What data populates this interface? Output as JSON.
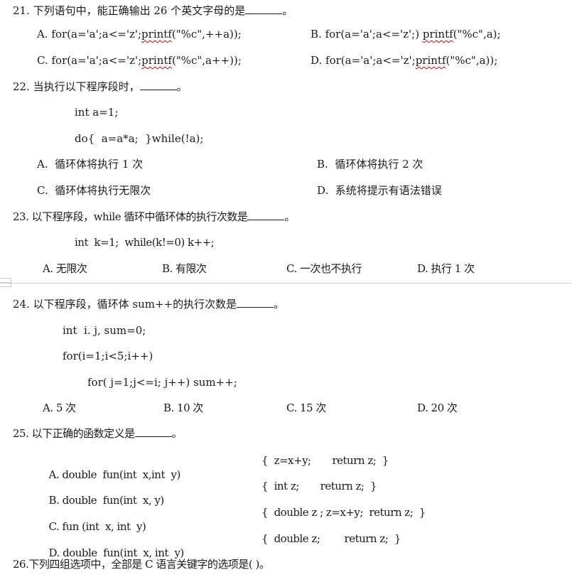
{
  "questions": {
    "q21": {
      "stem": "21. 下列语句中，能正确输出 26 个英文字母的是",
      "end": "。",
      "options": {
        "A": {
          "label": "A.",
          "pre": "for(a='a';a<='z';",
          "fn": "printf",
          "post": "(\"%c\",++a));"
        },
        "B": {
          "label": "B.",
          "pre": "for(a='a';a<='z';) ",
          "fn": "printf",
          "post": "(\"%c\",a);"
        },
        "C": {
          "label": "C.",
          "pre": "for(a='a';a<='z';",
          "fn": "printf",
          "post": "(\"%c\",a++));"
        },
        "D": {
          "label": "D.",
          "pre": "for(a='a';a<='z';",
          "fn": "printf",
          "post": "(\"%c\",a));"
        }
      }
    },
    "q22": {
      "stem": "22. 当执行以下程序段时，",
      "end": "。",
      "code": [
        "int a=1;",
        "do{  a=a*a;  }while(!a);"
      ],
      "options": {
        "A": "A.  循环体将执行 1 次",
        "B": "B.  循环体将执行 2 次",
        "C": "C.  循环体将执行无限次",
        "D": "D.  系统将提示有语法错误"
      }
    },
    "q23": {
      "stem": "23. 以下程序段，while 循环中循环体的执行次数是",
      "end": "。",
      "code": [
        "int  k=1;  while(k!=0) k++;"
      ],
      "options": {
        "A": "A. 无限次",
        "B": "B. 有限次",
        "C": "C. 一次也不执行",
        "D": "D. 执行 1 次"
      }
    },
    "q24": {
      "stem": "24. 以下程序段，循环体 sum++的执行次数是",
      "end": "。",
      "code": [
        "int  i. j, sum=0;",
        "for(i=1;i<5;i++)",
        "for( j=1;j<=i; j++) sum++;"
      ],
      "options": {
        "A": "A. 5 次",
        "B": "B. 10 次",
        "C": "C. 15 次",
        "D": "D. 20 次"
      }
    },
    "q25": {
      "stem": "25. 以下正确的函数定义是",
      "end": "。",
      "options": {
        "A": {
          "head": "A. double  fun(int  x,int  y)",
          "body": "{  z=x+y;       return z;  }"
        },
        "B": {
          "head": "B. double  fun(int  x, y)",
          "body": "{  int z;       return z;  }"
        },
        "C": {
          "head": "C. fun (int  x, int  y)",
          "body": "{  double z ; z=x+y;  return z;  }"
        },
        "D": {
          "head": "D. double  fun(int  x, int  y)",
          "body": "{  double z;        return z;  }"
        }
      }
    },
    "q26": {
      "stem": "26.下列四组选项中，全部是 C 语言关键字的选项是( )。"
    }
  },
  "colors": {
    "text": "#1a1a1a",
    "spellcheck": "#d00000",
    "pagebreak": "#d4d4d4"
  }
}
